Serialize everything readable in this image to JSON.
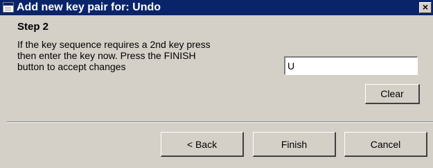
{
  "window": {
    "title": "Add new key pair for: Undo",
    "close_glyph": "×"
  },
  "step": {
    "title": "Step 2",
    "instruction_lines": [
      "If the key sequence requires a 2nd key press",
      "then enter the key now. Press the FINISH",
      "button to accept changes"
    ]
  },
  "key_input": {
    "value": "U",
    "placeholder": ""
  },
  "buttons": {
    "clear": "Clear",
    "back": "< Back",
    "finish": "Finish",
    "cancel": "Cancel"
  },
  "icons": {
    "window_icon": "window-icon",
    "close_icon": "close-icon"
  },
  "colors": {
    "title_bar": "#0a246a",
    "dialog_background": "#d4d0c8"
  }
}
